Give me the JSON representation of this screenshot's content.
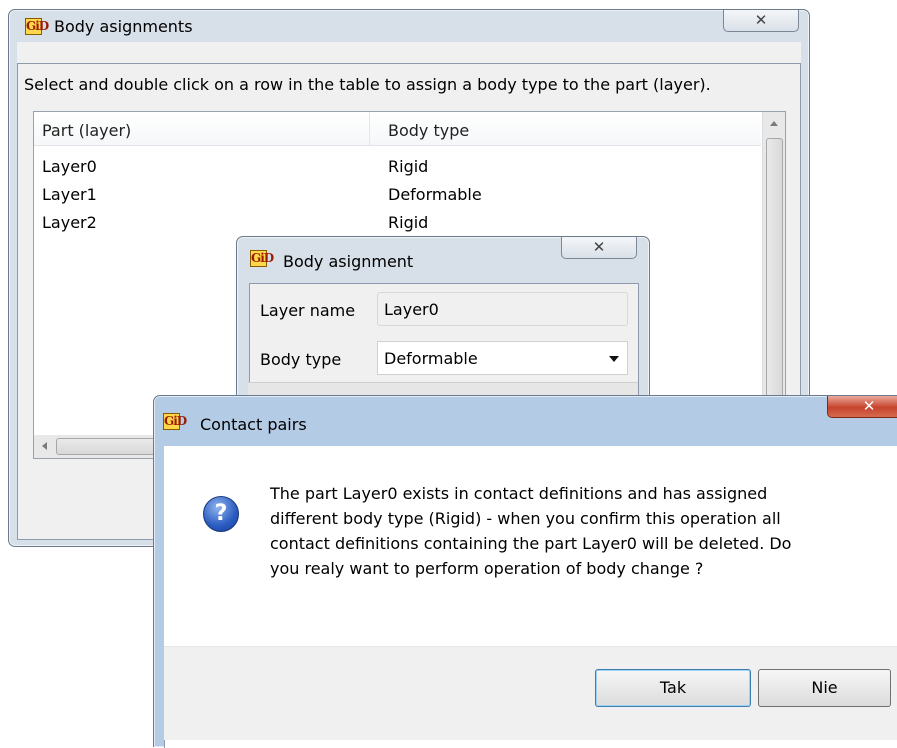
{
  "body_asignments_window": {
    "title": "Body asignments",
    "close": "✕",
    "instruction": "Select and double click on a row in the table to assign a body type to the part (layer).",
    "columns": [
      "Part (layer)",
      "Body type"
    ],
    "rows": [
      {
        "part": "Layer0",
        "body_type": "Rigid"
      },
      {
        "part": "Layer1",
        "body_type": "Deformable"
      },
      {
        "part": "Layer2",
        "body_type": "Rigid"
      }
    ]
  },
  "body_asignment_window": {
    "title": "Body asignment",
    "close": "✕",
    "layer_name_label": "Layer name",
    "layer_name_value": "Layer0",
    "body_type_label": "Body type",
    "body_type_value": "Deformable"
  },
  "contact_pairs_window": {
    "title": "Contact pairs",
    "close": "✕",
    "message_lines": [
      "The part Layer0 exists in contact definitions and has assigned",
      "different body type (Rigid) - when you confirm this operation all",
      "contact definitions containing the part Layer0 will be deleted. Do",
      "you realy want to perform operation of body change ?"
    ],
    "yes_label": "Tak",
    "no_label": "Nie"
  },
  "app_icon_text": "GiD",
  "icons": [
    "gid-app-icon",
    "close-icon",
    "question-icon",
    "scroll-up-arrow-icon",
    "scroll-left-arrow-icon",
    "dropdown-caret-icon"
  ],
  "colors": {
    "title_bar": "#b4cbe6",
    "close_active": "#c7432c",
    "question_icon": "#2a5bc0"
  }
}
